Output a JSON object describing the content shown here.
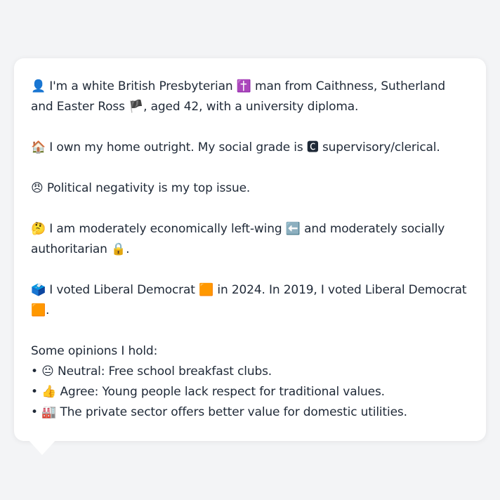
{
  "message": {
    "identity": {
      "icon": "👤",
      "text_a": "I'm a white British Presbyterian",
      "religion_icon": "✝️",
      "text_b": "man from Caithness, Sutherland and Easter Ross",
      "flag_icon": "🏴",
      "text_c": ", aged 42, with a university diploma."
    },
    "home": {
      "icon": "🏠",
      "text_a": "I own my home outright. My social grade is",
      "grade_icon": "🅲",
      "text_b": "supervisory/clerical."
    },
    "issue": {
      "icon": "😠",
      "text": "Political negativity is my top issue."
    },
    "ideology": {
      "icon": "🤔",
      "text_a": "I am moderately economically left-wing",
      "left_icon": "⬅️",
      "text_b": "and moderately socially authoritarian",
      "lock_icon": "🔒",
      "text_c": "."
    },
    "votes": {
      "icon": "🗳️",
      "text_a": "I voted Liberal Democrat",
      "party_icon_1": "🟧",
      "text_b": "in 2024. In 2019, I voted Liberal Democrat",
      "party_icon_2": "🟧",
      "text_c": "."
    },
    "opinions": {
      "heading": "Some opinions I hold:",
      "items": [
        {
          "bullet": "•",
          "icon": "😐",
          "text": "Neutral: Free school breakfast clubs."
        },
        {
          "bullet": "•",
          "icon": "👍",
          "text": "Agree: Young people lack respect for traditional values."
        },
        {
          "bullet": "•",
          "icon": "🏭",
          "text": "The private sector offers better value for domestic utilities."
        }
      ]
    }
  }
}
